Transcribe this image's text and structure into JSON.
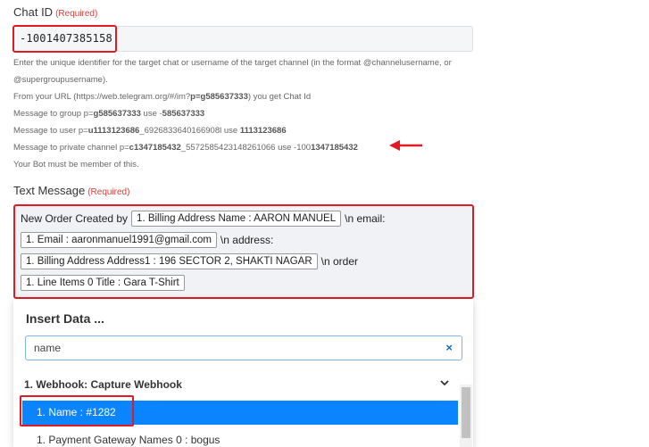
{
  "chat_id": {
    "label": "Chat ID",
    "required": "(Required)",
    "value": "-1001407385158"
  },
  "help": {
    "line1": "Enter the unique identifier for the target chat or username of the target channel (in the format @channelusername, or",
    "line2": "@supergroupusername).",
    "line3_prefix": "From your URL (https://web.telegram.org/#/im?",
    "line3_bold": "p=g585637333",
    "line3_suffix": ") you get Chat Id",
    "line4_prefix": "Message to group p=",
    "line4_bold1": "g585637333",
    "line4_mid": " use -",
    "line4_bold2": "585637333",
    "line5_prefix": "Message to user p=",
    "line5_bold1": "u1113123686",
    "line5_mid": "_6926833640166908l use ",
    "line5_bold2": "1113123686",
    "line6_prefix": "Message to private channel p=",
    "line6_bold1": "c1347185432",
    "line6_mid": "_5572585423148261066 use -100",
    "line6_bold2": "1347185432",
    "line7": "Your Bot must be member of this."
  },
  "text_message": {
    "label": "Text Message",
    "required": "(Required)",
    "line1_text": "New Order Created by",
    "pill1": "1. Billing Address Name : AARON MANUEL",
    "line1_after": "\\n email:",
    "pill2": "1. Email : aaronmanuel1991@gmail.com",
    "line2_after": "\\n address:",
    "pill3": "1. Billing Address Address1 : 196 SECTOR 2, SHAKTI NAGAR",
    "line3_after": "\\n order",
    "pill4": "1. Line Items 0 Title : Gara T-Shirt"
  },
  "insert_data": {
    "title": "Insert Data ...",
    "search_value": "name",
    "clear_label": "×",
    "group": "1. Webhook: Capture Webhook",
    "selected_item": "1. Name : #1282",
    "next_item": "1. Payment Gateway Names 0 : bogus"
  },
  "colors": {
    "accent": "#0a84ff",
    "highlight": "#e01b24"
  }
}
